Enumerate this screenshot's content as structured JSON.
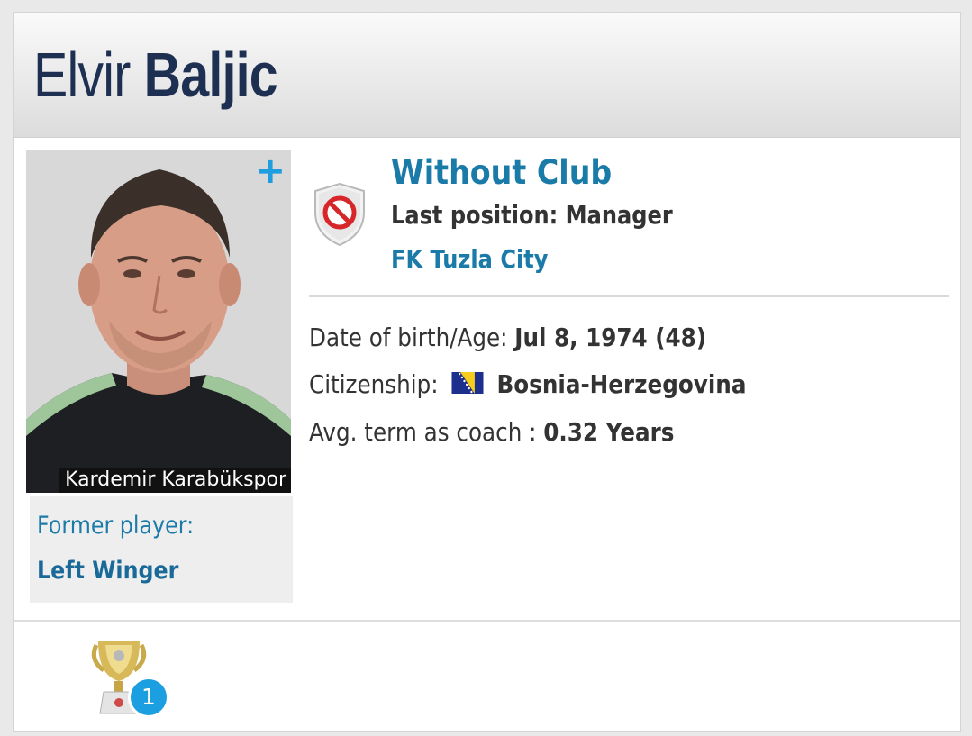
{
  "profile": {
    "first_name": "Elvir",
    "last_name": "Baljic"
  },
  "photo": {
    "caption": "Kardemir Karabükspor",
    "expand_icon": "plus-icon"
  },
  "former_player": {
    "label": "Former player:",
    "position": "Left Winger"
  },
  "current": {
    "status": "Without Club",
    "last_position_label": "Last position: Manager",
    "club": "FK Tuzla City",
    "club_icon": "no-club-shield-icon"
  },
  "details": {
    "dob_label": "Date of birth/Age: ",
    "dob_value": "Jul 8, 1974 (48)",
    "citizenship_label": "Citizenship:",
    "citizenship_value": "Bosnia-Herzegovina",
    "avg_term_label": "Avg. term as coach : ",
    "avg_term_value": "0.32 Years"
  },
  "trophies": {
    "icon": "trophy-icon",
    "count": "1"
  },
  "colors": {
    "name": "#1d3051",
    "link": "#1a7aa8",
    "badge": "#1b9fe0",
    "plus": "#1e9ede"
  }
}
